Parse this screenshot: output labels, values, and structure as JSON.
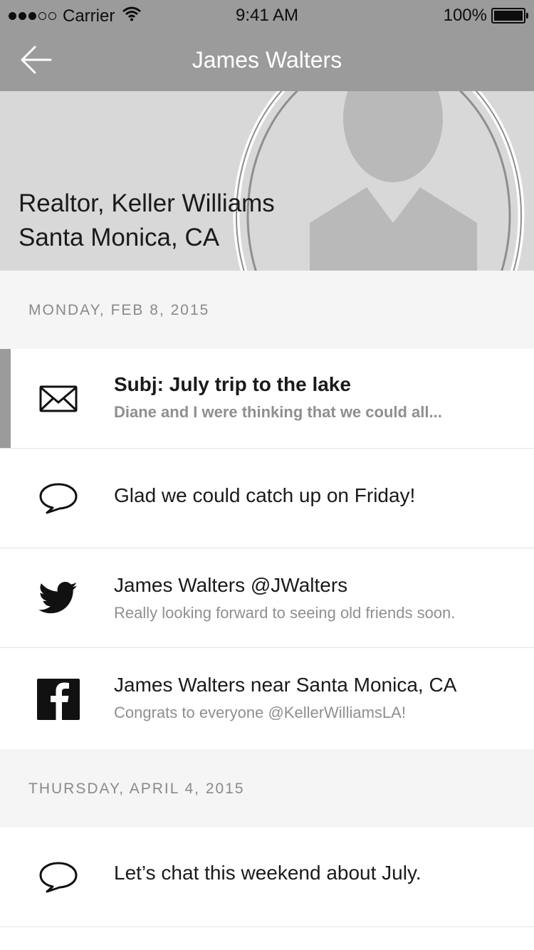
{
  "status_bar": {
    "carrier": "Carrier",
    "time": "9:41 AM",
    "battery": "100%",
    "signal_bars_filled": 3,
    "signal_bars_total": 5
  },
  "nav": {
    "back_icon": "arrow-left-icon",
    "title": "James Walters"
  },
  "profile": {
    "line1": "Realtor, Keller Williams",
    "line2": "Santa Monica, CA",
    "avatar_icon": "person-silhouette-icon"
  },
  "sections": [
    {
      "date": "MONDAY, FEB 8, 2015",
      "items": [
        {
          "icon": "envelope-icon",
          "title": "Subj:  July trip to the lake",
          "subtitle": "Diane and I were thinking that we could all..."
        },
        {
          "icon": "speech-bubble-icon",
          "title": "Glad we could catch up on Friday!"
        },
        {
          "icon": "twitter-icon",
          "title": "James Walters @JWalters",
          "subtitle": "Really looking forward to seeing old friends soon."
        },
        {
          "icon": "facebook-icon",
          "title": "James Walters near Santa Monica, CA",
          "subtitle": "Congrats to everyone @KellerWilliamsLA!"
        }
      ]
    },
    {
      "date": "THURSDAY, APRIL 4, 2015",
      "items": [
        {
          "icon": "speech-bubble-icon",
          "title": "Let’s chat this weekend about July."
        }
      ]
    }
  ],
  "colors": {
    "nav_background": "#9b9b9b",
    "hero_background": "#d8d8d8",
    "section_background": "#f5f5f5",
    "selected_indicator": "#9b9b9b"
  }
}
